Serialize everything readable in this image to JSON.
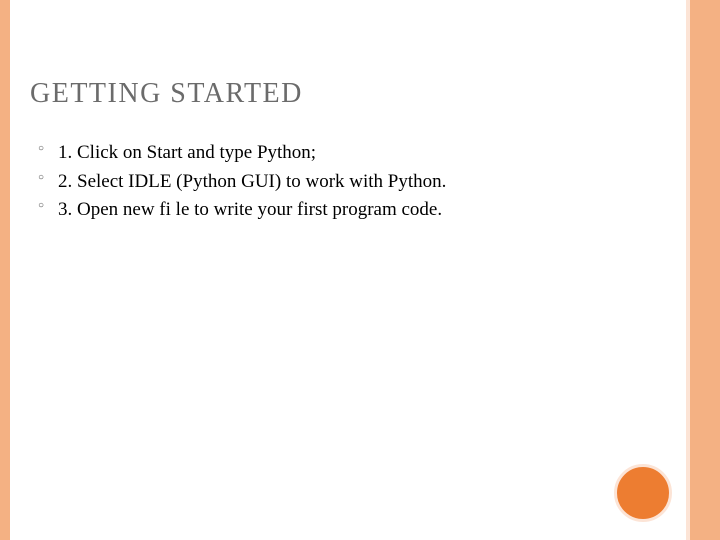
{
  "slide": {
    "title": "GETTING STARTED",
    "bullets": [
      "1. Click on Start and type Python;",
      "2. Select IDLE (Python GUI) to work with Python.",
      "3. Open new fi le to write your first program code."
    ]
  }
}
